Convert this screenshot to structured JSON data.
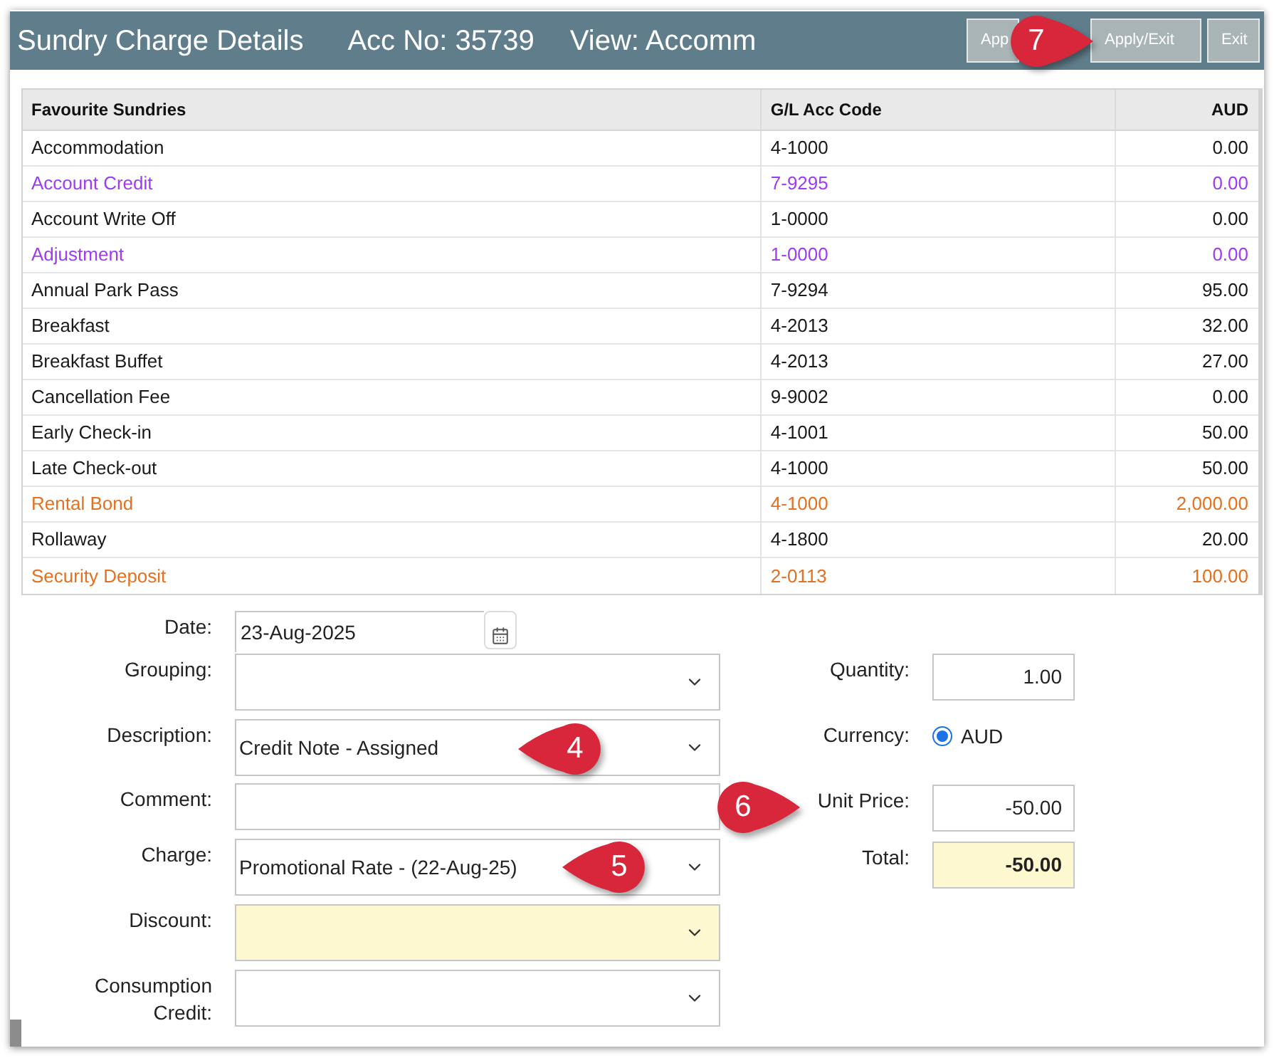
{
  "window": {
    "title": "Sundry Charge Details",
    "account": "Acc No: 35739",
    "view": "View: Accomm"
  },
  "toolbar_buttons": [
    {
      "label": "App"
    },
    {
      "label": "Apply/Exit",
      "callout": {
        "number": "7",
        "kind": "rightward"
      }
    },
    {
      "label": "Exit"
    }
  ],
  "table": {
    "columns": [
      "Favourite Sundries",
      "G/L Acc Code",
      "AUD"
    ],
    "rows": [
      {
        "cells": [
          "Accommodation",
          "4-1000",
          "0.00"
        ],
        "color": "#1a1a1a"
      },
      {
        "cells": [
          "Account Credit",
          "7-9295",
          "0.00"
        ],
        "color": "#9d3bf5"
      },
      {
        "cells": [
          "Account Write Off",
          "1-0000",
          "0.00"
        ],
        "color": "#1a1a1a"
      },
      {
        "cells": [
          "Adjustment",
          "1-0000",
          "0.00"
        ],
        "color": "#9d3bf5"
      },
      {
        "cells": [
          "Annual Park Pass",
          "7-9294",
          "95.00"
        ],
        "color": "#1a1a1a"
      },
      {
        "cells": [
          "Breakfast",
          "4-2013",
          "32.00"
        ],
        "color": "#1a1a1a"
      },
      {
        "cells": [
          "Breakfast Buffet",
          "4-2013",
          "27.00"
        ],
        "color": "#1a1a1a"
      },
      {
        "cells": [
          "Cancellation Fee",
          "9-9002",
          "0.00"
        ],
        "color": "#1a1a1a"
      },
      {
        "cells": [
          "Early Check-in",
          "4-1001",
          "50.00"
        ],
        "color": "#1a1a1a"
      },
      {
        "cells": [
          "Late Check-out",
          "4-1000",
          "50.00"
        ],
        "color": "#1a1a1a"
      },
      {
        "cells": [
          "Rental Bond",
          "4-1000",
          "2,000.00"
        ],
        "color": "#e3711f"
      },
      {
        "cells": [
          "Rollaway",
          "4-1800",
          "20.00"
        ],
        "color": "#1a1a1a"
      },
      {
        "cells": [
          "Security Deposit",
          "2-0113",
          "100.00"
        ],
        "color": "#e3711f"
      }
    ]
  },
  "form": {
    "left_fields": [
      {
        "label": "Date:",
        "kind": "date",
        "value": "23-Aug-2025",
        "highlighted": false
      },
      {
        "label": "Grouping:",
        "kind": "select",
        "highlighted": false
      },
      {
        "label": "Description:",
        "kind": "select",
        "value": "Credit Note - Assigned",
        "highlighted": false,
        "callout": {
          "number": "4",
          "kind": "leftward"
        }
      },
      {
        "label": "Comment:",
        "kind": "text",
        "highlighted": false
      },
      {
        "label": "Charge:",
        "kind": "select",
        "value": "Promotional Rate - (22-Aug-25)",
        "highlighted": false,
        "callout": {
          "number": "5",
          "kind": "leftward"
        }
      },
      {
        "label": "Discount:",
        "kind": "select",
        "highlighted": true
      },
      {
        "label": "Consumption Credit:",
        "kind": "select",
        "highlighted": false
      }
    ],
    "right_fields": [
      {
        "label": "Quantity:",
        "kind": "number",
        "value": "1.00",
        "highlighted": false
      },
      {
        "label": "Currency:",
        "kind": "radio",
        "options": [
          {
            "label": "AUD",
            "selected": true
          }
        ]
      },
      {
        "label": "Unit Price:",
        "kind": "number",
        "value": "-50.00",
        "highlighted": false,
        "callout": {
          "number": "6",
          "kind": "rightward"
        }
      },
      {
        "label": "Total:",
        "kind": "total",
        "value": "-50.00",
        "highlighted": true
      }
    ]
  }
}
